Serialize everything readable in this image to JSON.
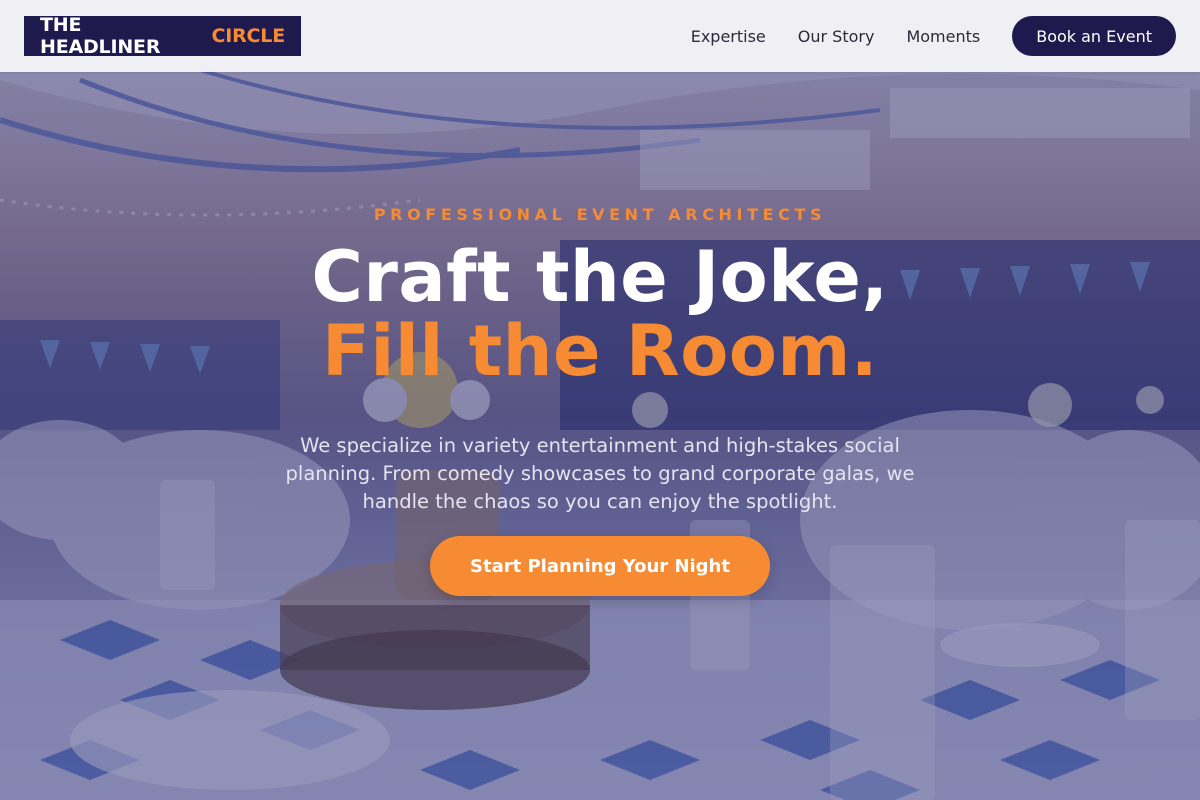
{
  "header": {
    "logo": {
      "main": "THE HEADLINER",
      "accent": "CIRCLE"
    },
    "nav": [
      {
        "label": "Expertise"
      },
      {
        "label": "Our Story"
      },
      {
        "label": "Moments"
      }
    ],
    "cta_label": "Book an Event"
  },
  "hero": {
    "eyebrow": "PROFESSIONAL EVENT ARCHITECTS",
    "headline_line1": "Craft the Joke,",
    "headline_line2": "Fill the Room.",
    "subtext": "We specialize in variety entertainment and high-stakes social planning. From comedy showcases to grand corporate galas, we handle the chaos so you can enjoy the spotlight.",
    "cta_label": "Start Planning Your Night"
  },
  "colors": {
    "brand_navy": "#1f1a4e",
    "accent_orange": "#f68b33",
    "overlay": "#26266e"
  }
}
